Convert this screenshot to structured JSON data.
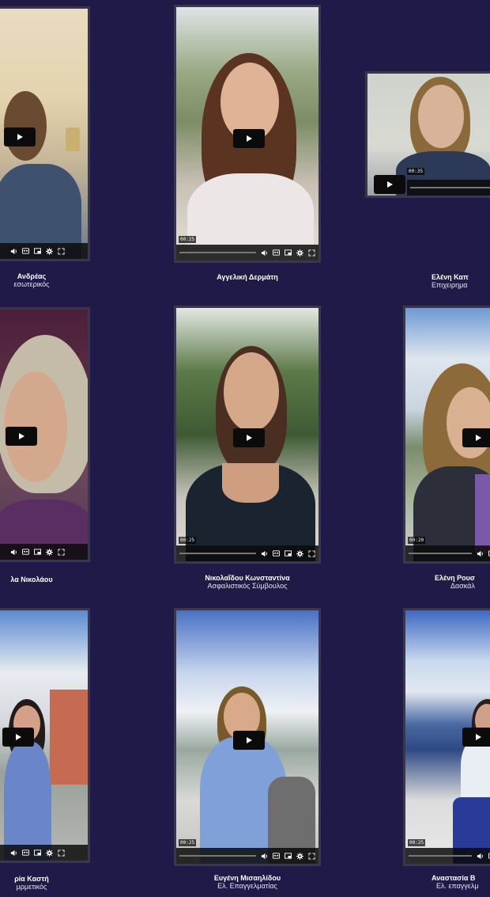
{
  "page": {
    "background_color": "#201a48",
    "border_color": "#3a3650"
  },
  "videos": [
    {
      "name": "Ανδρέας",
      "role": "εσωτερικός",
      "time": "",
      "scene": "indoor-man"
    },
    {
      "name": "Αγγελική Δερμάτη",
      "role": "",
      "time": "00:25",
      "scene": "outdoor-woman-brunette"
    },
    {
      "name": "Ελένη Καπ",
      "role": "Επιχειρημα",
      "time": "00:35",
      "scene": "indoor-woman-glasses"
    },
    {
      "name": "λα Νικολάου",
      "role": "",
      "time": "",
      "scene": "indoor-woman-blonde"
    },
    {
      "name": "Νικολαΐδου Κωνσταντίνα",
      "role": "Ασφαλιστικός Σύμβουλος",
      "time": "00:25",
      "scene": "outdoor-woman-trees"
    },
    {
      "name": "Ελένη Ρουσ",
      "role": "Δασκάλ",
      "time": "00:20",
      "scene": "outdoor-woman-windy"
    },
    {
      "name": "ρία Καστή",
      "role": "μρμετικός",
      "time": "",
      "scene": "street-woman"
    },
    {
      "name": "Ευγένη Μισαηλίδου",
      "role": "Ελ. Επαγγελματίας",
      "time": "00:25",
      "scene": "village-woman-waving"
    },
    {
      "name": "Αναστασία Β",
      "role": "Ελ. επαγγελμ",
      "time": "00:25",
      "scene": "sea-woman-seated"
    }
  ],
  "icons": {
    "play": "play-icon",
    "volume": "volume-icon",
    "captions": "captions-icon",
    "pip": "picture-in-picture-icon",
    "settings": "settings-gear-icon",
    "fullscreen": "fullscreen-icon"
  }
}
